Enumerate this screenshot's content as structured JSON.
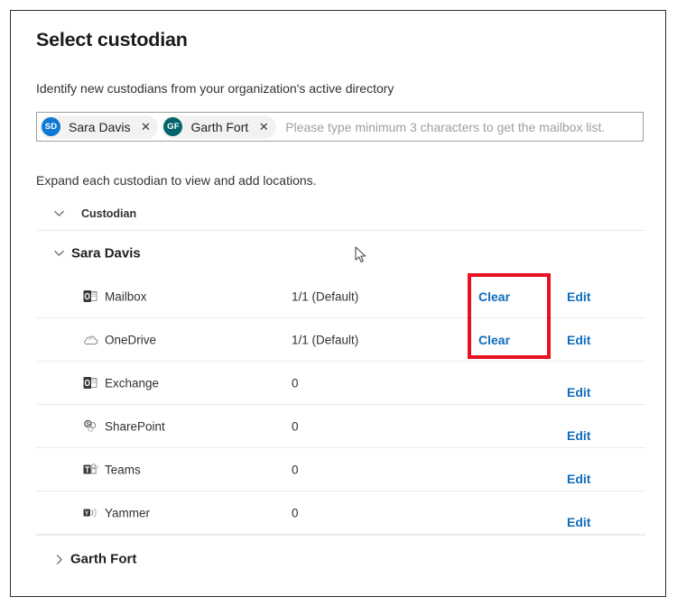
{
  "dialog": {
    "title": "Select custodian",
    "subtitle": "Identify new custodians from your organization's active directory",
    "expand_hint": "Expand each custodian to view and add locations."
  },
  "people_picker": {
    "placeholder": "Please type minimum 3 characters to get the mailbox list.",
    "value": "",
    "remove_glyph": "✕",
    "selected": [
      {
        "initials": "SD",
        "name": "Sara Davis",
        "avatar_color": "#0f78d4"
      },
      {
        "initials": "GF",
        "name": "Garth Fort",
        "avatar_color": "#03656b"
      }
    ]
  },
  "table": {
    "column_header": "Custodian",
    "custodians": [
      {
        "name": "Sara Davis",
        "expanded": true,
        "locations": [
          {
            "icon": "outlook-mailbox-icon",
            "label": "Mailbox",
            "count": "1/1 (Default)",
            "clear_label": "Clear",
            "edit_label": "Edit",
            "has_clear": true,
            "edit_low": false
          },
          {
            "icon": "onedrive-icon",
            "label": "OneDrive",
            "count": "1/1 (Default)",
            "clear_label": "Clear",
            "edit_label": "Edit",
            "has_clear": true,
            "edit_low": false
          },
          {
            "icon": "exchange-icon",
            "label": "Exchange",
            "count": "0",
            "clear_label": "",
            "edit_label": "Edit",
            "has_clear": false,
            "edit_low": true
          },
          {
            "icon": "sharepoint-icon",
            "label": "SharePoint",
            "count": "0",
            "clear_label": "",
            "edit_label": "Edit",
            "has_clear": false,
            "edit_low": true
          },
          {
            "icon": "teams-icon",
            "label": "Teams",
            "count": "0",
            "clear_label": "",
            "edit_label": "Edit",
            "has_clear": false,
            "edit_low": true
          },
          {
            "icon": "yammer-icon",
            "label": "Yammer",
            "count": "0",
            "clear_label": "",
            "edit_label": "Edit",
            "has_clear": false,
            "edit_low": true
          }
        ]
      },
      {
        "name": "Garth Fort",
        "expanded": false,
        "locations": []
      }
    ]
  },
  "annotation": {
    "color": "#e81123"
  }
}
